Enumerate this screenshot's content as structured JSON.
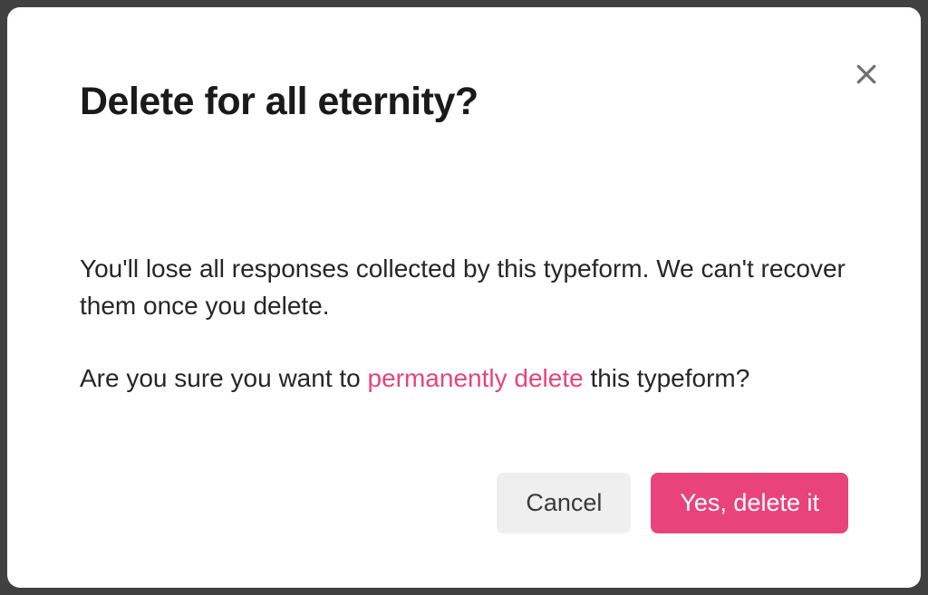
{
  "modal": {
    "title": "Delete for all eternity?",
    "body": {
      "paragraph1": "You'll lose all responses collected by this typeform. We can't recover them once you delete.",
      "paragraph2_prefix": "Are you sure you want to ",
      "paragraph2_highlight": "permanently delete",
      "paragraph2_suffix": " this typeform?"
    },
    "buttons": {
      "cancel": "Cancel",
      "confirm": "Yes, delete it"
    }
  },
  "colors": {
    "accent": "#e8437a",
    "cancelBg": "#efefef"
  }
}
